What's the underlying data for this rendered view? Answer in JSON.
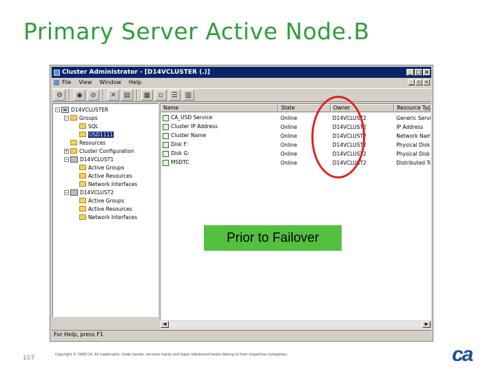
{
  "slide": {
    "title": "Primary Server Active Node.B",
    "callout": "Prior to Failover",
    "slide_number": "107",
    "copyright": "Copyright © 2006 CA. All trademarks, trade names, services marks and logos referenced herein belong to their respective companies.",
    "logo_text": "ca"
  },
  "window": {
    "title": "Cluster Administrator - [D14VCLUSTER (.)]",
    "menu": [
      "File",
      "View",
      "Window",
      "Help"
    ],
    "status": "For Help, press F1"
  },
  "tree": [
    {
      "label": "D14VCLUSTER",
      "icon": "cluster-icon",
      "expander": "−"
    },
    {
      "label": "Groups",
      "icon": "folder-icon",
      "expander": "−"
    },
    {
      "label": "SQL",
      "icon": "folder-icon",
      "expander": ""
    },
    {
      "label": "USD1111",
      "icon": "folder-icon",
      "expander": "",
      "selected": true
    },
    {
      "label": "Resources",
      "icon": "folder-icon",
      "expander": ""
    },
    {
      "label": "Cluster Configuration",
      "icon": "folder-icon",
      "expander": "+"
    },
    {
      "label": "D14VCLUST1",
      "icon": "node-icon",
      "expander": "−"
    },
    {
      "label": "Active Groups",
      "icon": "folder-icon",
      "expander": ""
    },
    {
      "label": "Active Resources",
      "icon": "folder-icon",
      "expander": ""
    },
    {
      "label": "Network Interfaces",
      "icon": "folder-icon",
      "expander": ""
    },
    {
      "label": "D14VCLUST2",
      "icon": "node-icon",
      "expander": "−"
    },
    {
      "label": "Active Groups",
      "icon": "folder-icon",
      "expander": ""
    },
    {
      "label": "Active Resources",
      "icon": "folder-icon",
      "expander": ""
    },
    {
      "label": "Network Interfaces",
      "icon": "folder-icon",
      "expander": ""
    }
  ],
  "list": {
    "columns": [
      "Name",
      "State",
      "Owner",
      "Resource Type"
    ],
    "rows": [
      [
        "CA_USD Service",
        "Online",
        "D14VCLUST2",
        "Generic Service"
      ],
      [
        "Cluster IP Address",
        "Online",
        "D14VCLUST2",
        "IP Address"
      ],
      [
        "Cluster Name",
        "Online",
        "D14VCLUST2",
        "Network Name"
      ],
      [
        "Disk F:",
        "Online",
        "D14VCLUST2",
        "Physical Disk"
      ],
      [
        "Disk G:",
        "Online",
        "D14VCLUST2",
        "Physical Disk"
      ],
      [
        "MSDTC",
        "Online",
        "D14VCLUST2",
        "Distributed Tr"
      ]
    ]
  },
  "colors": {
    "title_green": "#2f9e3a",
    "callout_green": "#53c03f",
    "highlight_red": "#e02020",
    "logo_blue": "#1a4fa0"
  }
}
